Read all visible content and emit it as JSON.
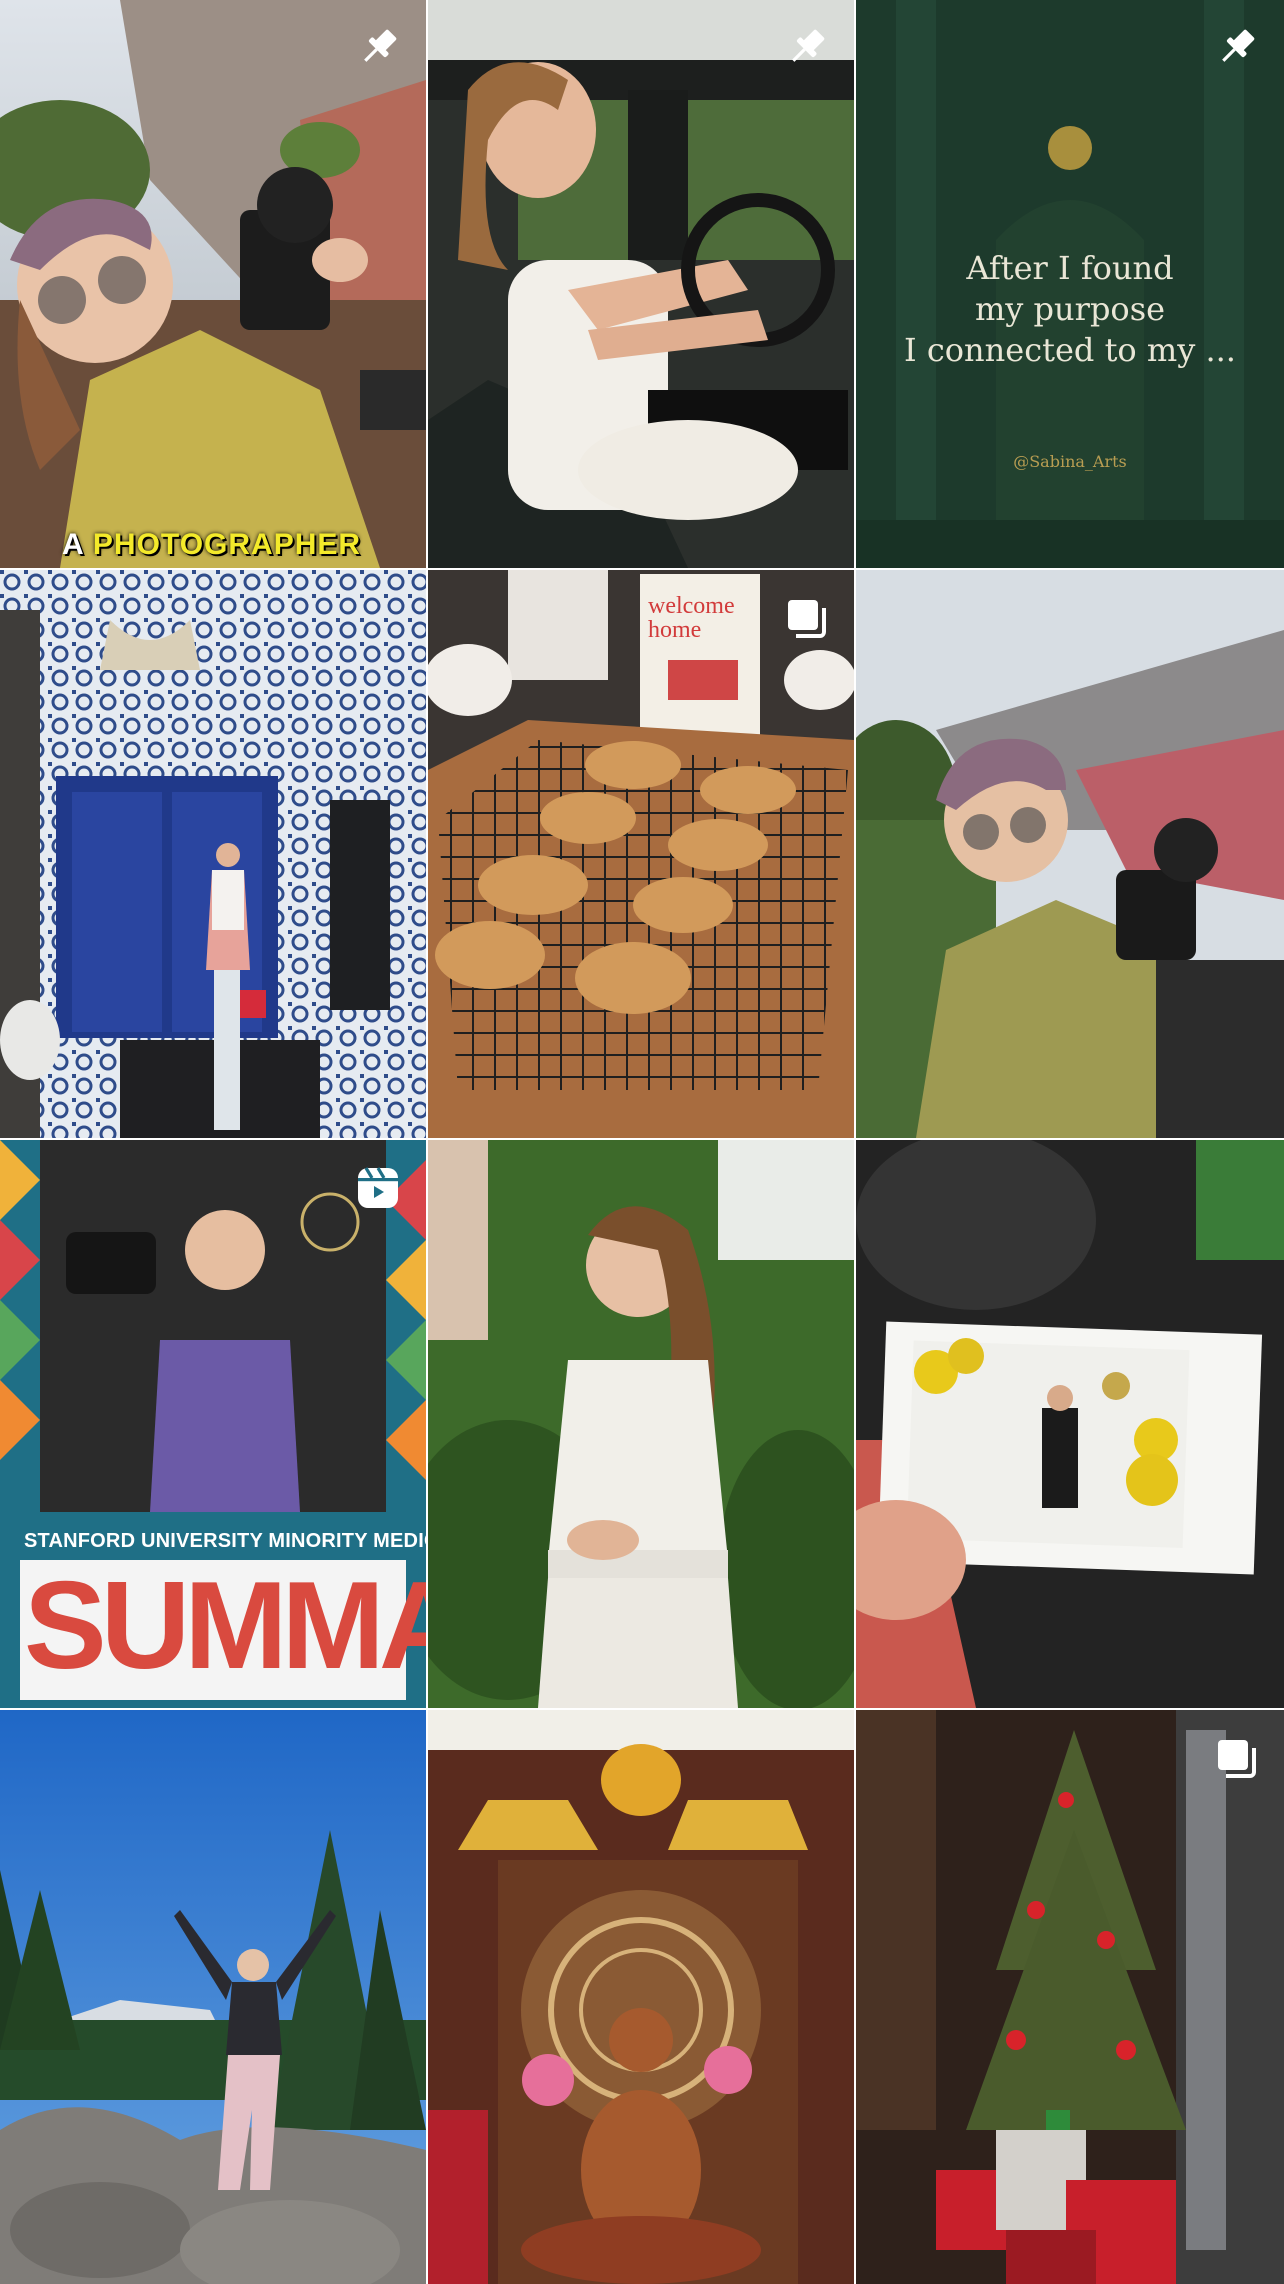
{
  "grid": {
    "tiles": [
      {
        "id": "t1",
        "icon": "pin-icon",
        "caption_prefix": "A",
        "caption_main": "PHOTOGRAPHER"
      },
      {
        "id": "t2",
        "icon": "pin-icon"
      },
      {
        "id": "t3",
        "icon": "pin-icon",
        "quote_line1": "After I found",
        "quote_line2": "my purpose",
        "quote_line3": "I connected to my ...",
        "handle": "@Sabina_Arts"
      },
      {
        "id": "t4"
      },
      {
        "id": "t5",
        "icon": "carousel-icon",
        "card_line1": "welcome",
        "card_line2": "home"
      },
      {
        "id": "t6"
      },
      {
        "id": "t7",
        "icon": "reels-icon",
        "org_line": "STANFORD UNIVERSITY MINORITY MEDICAL ALLIANCE",
        "org_word": "SUMMA"
      },
      {
        "id": "t8"
      },
      {
        "id": "t9"
      },
      {
        "id": "t10"
      },
      {
        "id": "t11"
      },
      {
        "id": "t12",
        "icon": "carousel-icon"
      }
    ]
  },
  "colors": {
    "grid_gap": "#ffffff",
    "quote_bg": "#1d3a2c",
    "stumma_bg": "#1f6f86"
  }
}
